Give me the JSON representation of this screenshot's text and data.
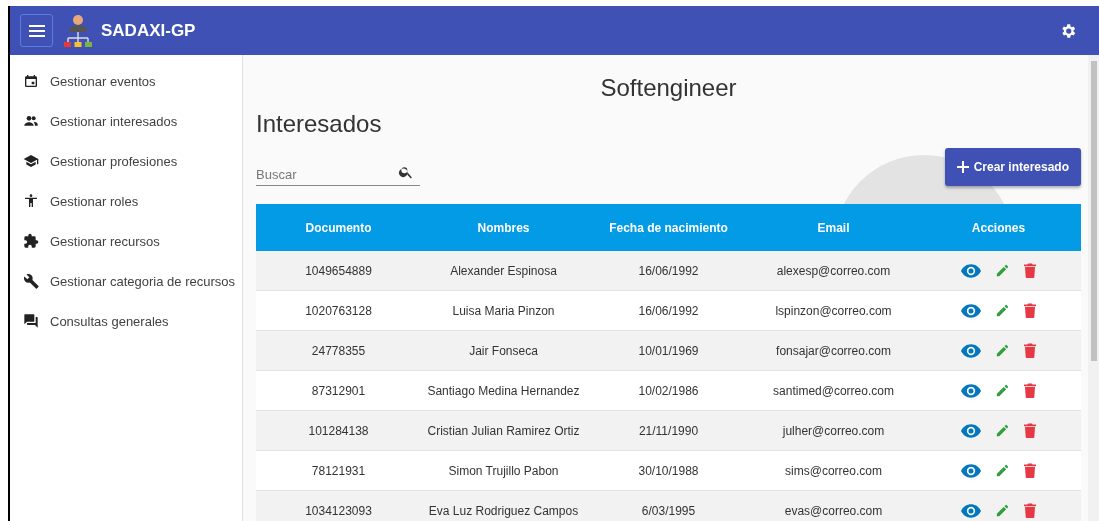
{
  "app": {
    "title": "SADAXI-GP"
  },
  "sidebar": {
    "items": [
      {
        "label": "Gestionar eventos"
      },
      {
        "label": "Gestionar interesados"
      },
      {
        "label": "Gestionar profesiones"
      },
      {
        "label": "Gestionar roles"
      },
      {
        "label": "Gestionar recursos"
      },
      {
        "label": "Gestionar categoria de recursos"
      },
      {
        "label": "Consultas generales"
      }
    ]
  },
  "main": {
    "company": "Softengineer",
    "heading": "Interesados",
    "search": {
      "placeholder": "Buscar"
    },
    "create_button": "Crear interesado"
  },
  "table": {
    "columns": [
      "Documento",
      "Nombres",
      "Fecha de nacimiento",
      "Email",
      "Acciones"
    ],
    "rows": [
      [
        "1049654889",
        "Alexander Espinosa",
        "16/06/1992",
        "alexesp@correo.com"
      ],
      [
        "1020763128",
        "Luisa Maria Pinzon",
        "16/06/1992",
        "lspinzon@correo.com"
      ],
      [
        "24778355",
        "Jair Fonseca",
        "10/01/1969",
        "fonsajar@correo.com"
      ],
      [
        "87312901",
        "Santiago Medina Hernandez",
        "10/02/1986",
        "santimed@correo.com"
      ],
      [
        "101284138",
        "Cristian Julian Ramirez Ortiz",
        "21/11/1990",
        "julher@correo.com"
      ],
      [
        "78121931",
        "Simon Trujillo Pabon",
        "30/10/1988",
        "sims@correo.com"
      ],
      [
        "1034123093",
        "Eva Luz Rodriguez Campos",
        "6/03/1995",
        "evas@correo.com"
      ]
    ]
  }
}
